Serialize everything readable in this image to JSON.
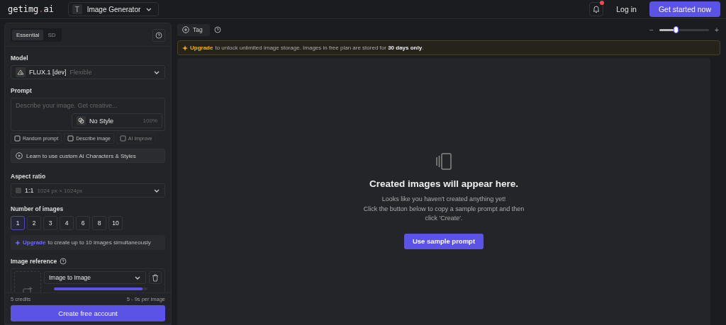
{
  "header": {
    "logo_left": "getimg",
    "logo_dot": ".",
    "logo_right": "ai",
    "tool_selector": {
      "icon": "T",
      "label": "Image Generator"
    },
    "notification": {
      "unread": true
    },
    "login": "Log in",
    "cta": "Get started now"
  },
  "panel": {
    "tabs": [
      {
        "label": "Essential",
        "selected": true
      },
      {
        "label": "SD",
        "selected": false
      }
    ],
    "model": {
      "label": "Model",
      "name": "FLUX.1 [dev]",
      "tag": "Flexible"
    },
    "prompt": {
      "label": "Prompt",
      "placeholder": "Describe your image. Get creative...",
      "style": "No Style",
      "style_strength": "100%"
    },
    "prompt_actions": [
      {
        "label": "Random prompt",
        "disabled": false
      },
      {
        "label": "Describe image",
        "disabled": false
      },
      {
        "label": "AI Improve",
        "disabled": true
      }
    ],
    "learn": "Learn to use custom AI Characters & Styles",
    "aspect": {
      "label": "Aspect ratio",
      "ratio": "1:1",
      "size": "1024 px × 1024px"
    },
    "count": {
      "label": "Number of images",
      "options": [
        {
          "label": "1",
          "selected": true
        },
        {
          "label": "2",
          "selected": false
        },
        {
          "label": "3",
          "selected": false
        },
        {
          "label": "4",
          "selected": false
        },
        {
          "label": "6",
          "selected": false
        },
        {
          "label": "8",
          "selected": false
        },
        {
          "label": "10",
          "selected": false
        }
      ]
    },
    "count_upgrade": {
      "link": "Upgrade",
      "text": "to create up to 10 images simultaneously"
    },
    "reference": {
      "label": "Image reference",
      "mode": "Image to Image",
      "strength": {
        "level": 0.95
      }
    },
    "credits": "5 credits",
    "speed": "5 - 9s per image",
    "create": "Create free account"
  },
  "main": {
    "tag": "Tag",
    "zoom": {
      "minus": "−",
      "plus": "+",
      "level": 0.33
    },
    "banner": {
      "link": "Upgrade",
      "text": "to unlock unlimited image storage. Images in free plan are stored for",
      "bold": "30 days only",
      "end": "."
    },
    "empty": {
      "title": "Created images will appear here.",
      "line1": "Looks like you haven't created anything yet!",
      "line2": "Click the button below to copy a sample prompt and then click 'Create'.",
      "button": "Use sample prompt"
    }
  }
}
